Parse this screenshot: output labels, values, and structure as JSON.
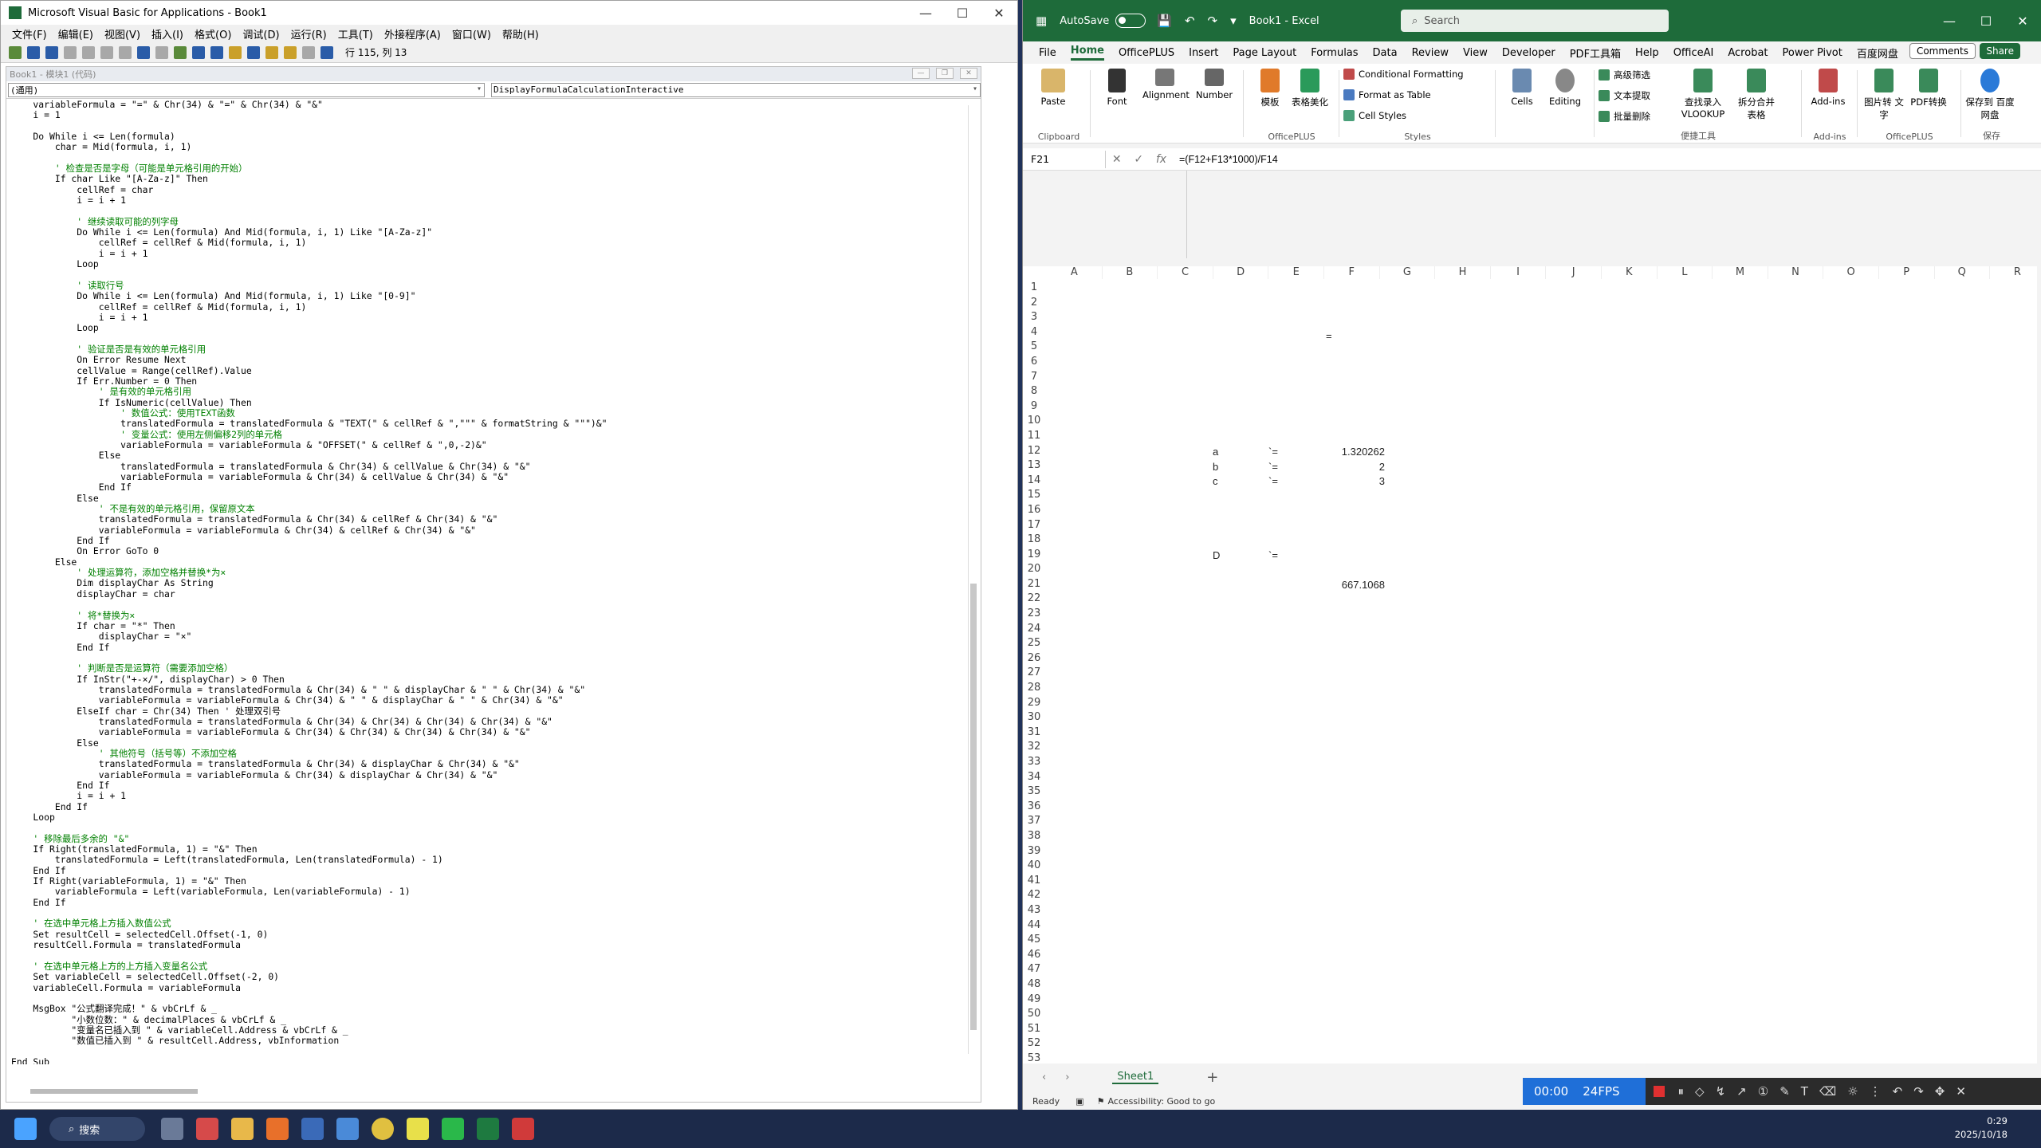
{
  "vba": {
    "title": "Microsoft Visual Basic for Applications - Book1",
    "menu": [
      "文件(F)",
      "编辑(E)",
      "视图(V)",
      "插入(I)",
      "格式(O)",
      "调试(D)",
      "运行(R)",
      "工具(T)",
      "外接程序(A)",
      "窗口(W)",
      "帮助(H)"
    ],
    "cursor_pos": "行 115, 列 13",
    "code_window_title": "Book1 - 模块1 (代码)",
    "combo_left": "(通用)",
    "combo_right": "DisplayFormulaCalculationInteractive",
    "code_lines": [
      "    variableFormula = \"=\" & Chr(34) & \"=\" & Chr(34) & \"&\"",
      "    i = 1",
      "",
      "    Do While i <= Len(formula)",
      "        char = Mid(formula, i, 1)",
      "",
      "        ' 检查是否是字母（可能是单元格引用的开始）",
      "        If char Like \"[A-Za-z]\" Then",
      "            cellRef = char",
      "            i = i + 1",
      "",
      "            ' 继续读取可能的列字母",
      "            Do While i <= Len(formula) And Mid(formula, i, 1) Like \"[A-Za-z]\"",
      "                cellRef = cellRef & Mid(formula, i, 1)",
      "                i = i + 1",
      "            Loop",
      "",
      "            ' 读取行号",
      "            Do While i <= Len(formula) And Mid(formula, i, 1) Like \"[0-9]\"",
      "                cellRef = cellRef & Mid(formula, i, 1)",
      "                i = i + 1",
      "            Loop",
      "",
      "            ' 验证是否是有效的单元格引用",
      "            On Error Resume Next",
      "            cellValue = Range(cellRef).Value",
      "            If Err.Number = 0 Then",
      "                ' 是有效的单元格引用",
      "                If IsNumeric(cellValue) Then",
      "                    ' 数值公式：使用TEXT函数",
      "                    translatedFormula = translatedFormula & \"TEXT(\" & cellRef & \",\"\"\" & formatString & \"\"\")&\"",
      "                    ' 变量公式：使用左侧偏移2列的单元格",
      "                    variableFormula = variableFormula & \"OFFSET(\" & cellRef & \",0,-2)&\"",
      "                Else",
      "                    translatedFormula = translatedFormula & Chr(34) & cellValue & Chr(34) & \"&\"",
      "                    variableFormula = variableFormula & Chr(34) & cellValue & Chr(34) & \"&\"",
      "                End If",
      "            Else",
      "                ' 不是有效的单元格引用，保留原文本",
      "                translatedFormula = translatedFormula & Chr(34) & cellRef & Chr(34) & \"&\"",
      "                variableFormula = variableFormula & Chr(34) & cellRef & Chr(34) & \"&\"",
      "            End If",
      "            On Error GoTo 0",
      "        Else",
      "            ' 处理运算符，添加空格并替换*为×",
      "            Dim displayChar As String",
      "            displayChar = char",
      "",
      "            ' 将*替换为×",
      "            If char = \"*\" Then",
      "                displayChar = \"×\"",
      "            End If",
      "",
      "            ' 判断是否是运算符（需要添加空格）",
      "            If InStr(\"+-×/\", displayChar) > 0 Then",
      "                translatedFormula = translatedFormula & Chr(34) & \" \" & displayChar & \" \" & Chr(34) & \"&\"",
      "                variableFormula = variableFormula & Chr(34) & \" \" & displayChar & \" \" & Chr(34) & \"&\"",
      "            ElseIf char = Chr(34) Then ' 处理双引号",
      "                translatedFormula = translatedFormula & Chr(34) & Chr(34) & Chr(34) & Chr(34) & \"&\"",
      "                variableFormula = variableFormula & Chr(34) & Chr(34) & Chr(34) & Chr(34) & \"&\"",
      "            Else",
      "                ' 其他符号（括号等）不添加空格",
      "                translatedFormula = translatedFormula & Chr(34) & displayChar & Chr(34) & \"&\"",
      "                variableFormula = variableFormula & Chr(34) & displayChar & Chr(34) & \"&\"",
      "            End If",
      "            i = i + 1",
      "        End If",
      "    Loop",
      "",
      "    ' 移除最后多余的 \"&\"",
      "    If Right(translatedFormula, 1) = \"&\" Then",
      "        translatedFormula = Left(translatedFormula, Len(translatedFormula) - 1)",
      "    End If",
      "    If Right(variableFormula, 1) = \"&\" Then",
      "        variableFormula = Left(variableFormula, Len(variableFormula) - 1)",
      "    End If",
      "",
      "    ' 在选中单元格上方插入数值公式",
      "    Set resultCell = selectedCell.Offset(-1, 0)",
      "    resultCell.Formula = translatedFormula",
      "",
      "    ' 在选中单元格上方的上方插入变量名公式",
      "    Set variableCell = selectedCell.Offset(-2, 0)",
      "    variableCell.Formula = variableFormula",
      "",
      "    MsgBox \"公式翻译完成！\" & vbCrLf & _",
      "           \"小数位数：\" & decimalPlaces & vbCrLf & _",
      "           \"变量名已插入到 \" & variableCell.Address & vbCrLf & _",
      "           \"数值已插入到 \" & resultCell.Address, vbInformation",
      "",
      "End Sub"
    ]
  },
  "excel": {
    "autosave": "AutoSave",
    "book": "Book1 - Excel",
    "search_placeholder": "Search",
    "tabs": [
      "File",
      "Home",
      "OfficePLUS",
      "Insert",
      "Page Layout",
      "Formulas",
      "Data",
      "Review",
      "View",
      "Developer",
      "PDF工具箱",
      "Help",
      "OfficeAI",
      "Acrobat",
      "Power Pivot",
      "百度网盘"
    ],
    "comments": "Comments",
    "share": "Share",
    "ribbon": {
      "paste": "Paste",
      "clipboard": "Clipboard",
      "font": "Font",
      "alignment": "Alignment",
      "number": "Number",
      "muban": "模板",
      "meihua": "表格美化",
      "officeplus": "OfficePLUS",
      "cond_fmt": "Conditional Formatting",
      "fmt_table": "Format as Table",
      "cell_styles": "Cell Styles",
      "styles": "Styles",
      "cells": "Cells",
      "editing": "Editing",
      "gaoji": "高级筛选",
      "wenben": "文本提取",
      "piliang": "批量删除",
      "chazhao": "查找录入 VLOOKUP",
      "chaifen": "拆分合并 表格",
      "bianjie": "便捷工具",
      "addins": "Add-ins",
      "addins_group": "Add-ins",
      "tupian": "图片转 文字",
      "pdfzh": "PDF转换",
      "officeplus2": "OfficePLUS",
      "baocun": "保存到 百度网盘",
      "baocun_group": "保存"
    },
    "name_box": "F21",
    "formula": "=(F12+F13*1000)/F14",
    "columns": [
      "A",
      "B",
      "C",
      "D",
      "E",
      "F",
      "G",
      "H",
      "I",
      "J",
      "K",
      "L",
      "M",
      "N",
      "O",
      "P",
      "Q",
      "R"
    ],
    "rows": [
      "1",
      "2",
      "3",
      "4",
      "5",
      "6",
      "7",
      "8",
      "9",
      "10",
      "11",
      "12",
      "13",
      "14",
      "15",
      "16",
      "17",
      "18",
      "19",
      "20",
      "21",
      "22",
      "23",
      "24",
      "25",
      "26",
      "27",
      "28",
      "29",
      "30",
      "31",
      "32",
      "33",
      "34",
      "35",
      "36",
      "37",
      "38",
      "39",
      "40",
      "41",
      "42",
      "43",
      "44",
      "45",
      "46",
      "47",
      "48",
      "49",
      "50",
      "51",
      "52",
      "53"
    ],
    "cells": {
      "f4": "=",
      "d12": "a",
      "e12": "`=",
      "f12": "1.320262",
      "d13": "b",
      "e13": "`=",
      "f13": "2",
      "d14": "c",
      "e14": "`=",
      "f14": "3",
      "d19": "D",
      "e19": "`=",
      "f21": "667.1068"
    },
    "sheet": "Sheet1",
    "status_ready": "Ready",
    "accessibility": "Accessibility: Good to go"
  },
  "recorder": {
    "time": "00:00",
    "fps": "24FPS"
  },
  "taskbar": {
    "search": "搜索",
    "time": "0:29",
    "date": "2025/10/18"
  }
}
